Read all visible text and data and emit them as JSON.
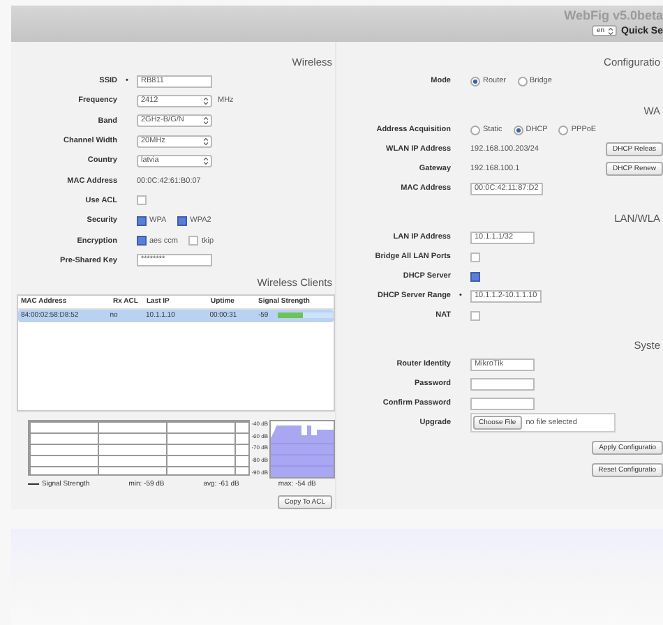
{
  "header": {
    "title": "WebFig v5.0beta",
    "language": "en",
    "quick_set": "Quick Se"
  },
  "wireless": {
    "heading": "Wireless",
    "rows": [
      {
        "kind": "input",
        "label": "SSID",
        "marker": "•",
        "value": "RB811"
      },
      {
        "kind": "select",
        "label": "Frequency",
        "value": "2412",
        "unit": "MHz"
      },
      {
        "kind": "select",
        "label": "Band",
        "value": "2GHz-B/G/N"
      },
      {
        "kind": "select",
        "label": "Channel Width",
        "value": "20MHz"
      },
      {
        "kind": "select",
        "label": "Country",
        "value": "latvia"
      },
      {
        "kind": "text",
        "label": "MAC Address",
        "value": "00:0C:42:61:B0:07"
      },
      {
        "kind": "checkbox",
        "label": "Use ACL",
        "checked": false
      },
      {
        "kind": "checks",
        "label": "Security",
        "options": [
          {
            "label": "WPA",
            "checked": true
          },
          {
            "label": "WPA2",
            "checked": true
          }
        ]
      },
      {
        "kind": "checks",
        "label": "Encryption",
        "options": [
          {
            "label": "aes ccm",
            "checked": true
          },
          {
            "label": "tkip",
            "checked": false
          }
        ]
      },
      {
        "kind": "input",
        "label": "Pre-Shared Key",
        "value": "********"
      }
    ]
  },
  "clients": {
    "heading": "Wireless Clients",
    "columns": [
      "MAC Address",
      "Rx ACL",
      "Last IP",
      "Uptime",
      "Signal Strength"
    ],
    "rows": [
      {
        "selected": true,
        "cells": [
          "84:00:02:58:D8:52",
          "no",
          "10.1.1.10",
          "00:00:31"
        ],
        "signal": "-59",
        "level": 0.45
      }
    ],
    "graph": {
      "y_labels": [
        "-40 dB",
        "-60 dB",
        "-70 dB",
        "-80 dB",
        "-90 dB"
      ],
      "legend": "Signal Strength",
      "min": "min: -59 dB",
      "avg": "avg: -61 dB",
      "max": "max: -54 dB"
    },
    "button": "Copy To ACL"
  },
  "config": {
    "sections": [
      {
        "heading": "Configuratio",
        "rows": [
          {
            "kind": "radios",
            "label": "Mode",
            "options": [
              {
                "label": "Router",
                "selected": true
              },
              {
                "label": "Bridge",
                "selected": false
              }
            ]
          }
        ]
      },
      {
        "heading": "WA",
        "side_buttons": [
          "DHCP Releas",
          "DHCP Renew"
        ],
        "rows": [
          {
            "kind": "radios",
            "label": "Address Acquisition",
            "options": [
              {
                "label": "Static",
                "selected": false
              },
              {
                "label": "DHCP",
                "selected": true
              },
              {
                "label": "PPPoE",
                "selected": false
              }
            ]
          },
          {
            "kind": "text",
            "label": "WLAN IP Address",
            "value": "192.168.100.203/24"
          },
          {
            "kind": "text",
            "label": "Gateway",
            "value": "192.168.100.1"
          },
          {
            "kind": "input",
            "label": "MAC Address",
            "value": "00:0C:42:11:87:D2"
          }
        ]
      },
      {
        "heading": "LAN/WLA",
        "rows": [
          {
            "kind": "input",
            "label": "LAN IP Address",
            "value": "10.1.1.1/32"
          },
          {
            "kind": "checkbox",
            "label": "Bridge All LAN Ports",
            "checked": false
          },
          {
            "kind": "checkbox",
            "label": "DHCP Server",
            "checked": true
          },
          {
            "kind": "input",
            "label": "DHCP Server Range",
            "marker": "•",
            "value": "10.1.1.2-10.1.1.10"
          },
          {
            "kind": "checkbox",
            "label": "NAT",
            "checked": false
          }
        ]
      },
      {
        "heading": "Syste",
        "rows": [
          {
            "kind": "input",
            "label": "Router Identity",
            "value": "MikroTik"
          },
          {
            "kind": "input",
            "label": "Password"
          },
          {
            "kind": "input",
            "label": "Confirm Password"
          },
          {
            "kind": "file",
            "label": "Upgrade",
            "button": "Choose File",
            "value": "no file selected"
          }
        ],
        "buttons": [
          "Apply Configuratio",
          "Reset Configuratio"
        ]
      }
    ]
  }
}
